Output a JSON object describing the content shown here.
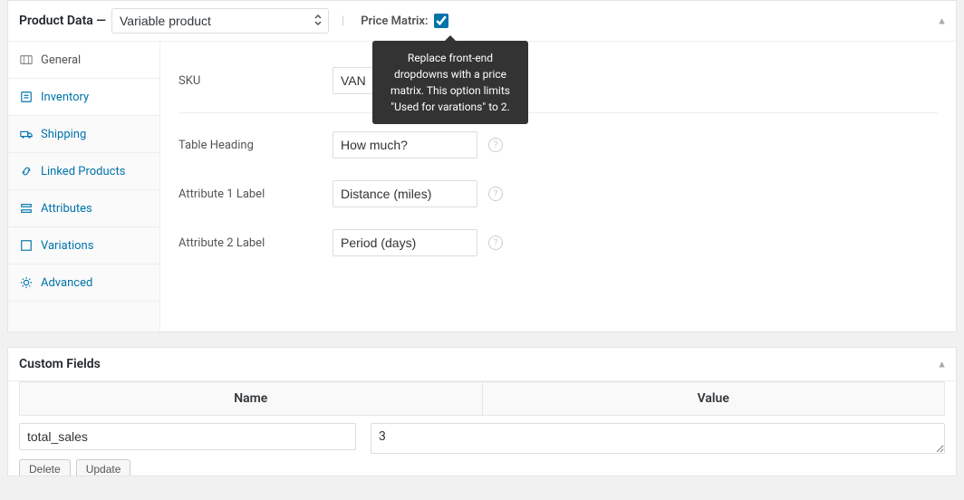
{
  "product_data": {
    "title": "Product Data —",
    "type_selected": "Variable product",
    "price_matrix_label": "Price Matrix:",
    "price_matrix_checked": true,
    "tooltip": "Replace front-end dropdowns with a price matrix. This option limits \"Used for varations\" to 2.",
    "tabs": [
      {
        "key": "general",
        "label": "General"
      },
      {
        "key": "inventory",
        "label": "Inventory"
      },
      {
        "key": "shipping",
        "label": "Shipping"
      },
      {
        "key": "linked",
        "label": "Linked Products"
      },
      {
        "key": "attributes",
        "label": "Attributes"
      },
      {
        "key": "variations",
        "label": "Variations"
      },
      {
        "key": "advanced",
        "label": "Advanced"
      }
    ],
    "fields": {
      "sku": {
        "label": "SKU",
        "value": "VAN"
      },
      "table_heading": {
        "label": "Table Heading",
        "value": "How much?"
      },
      "attr1": {
        "label": "Attribute 1 Label",
        "value": "Distance (miles)"
      },
      "attr2": {
        "label": "Attribute 2 Label",
        "value": "Period (days)"
      }
    }
  },
  "custom_fields": {
    "title": "Custom Fields",
    "columns": {
      "name": "Name",
      "value": "Value"
    },
    "rows": [
      {
        "name": "total_sales",
        "value": "3"
      }
    ],
    "actions": {
      "delete": "Delete",
      "update": "Update"
    }
  }
}
